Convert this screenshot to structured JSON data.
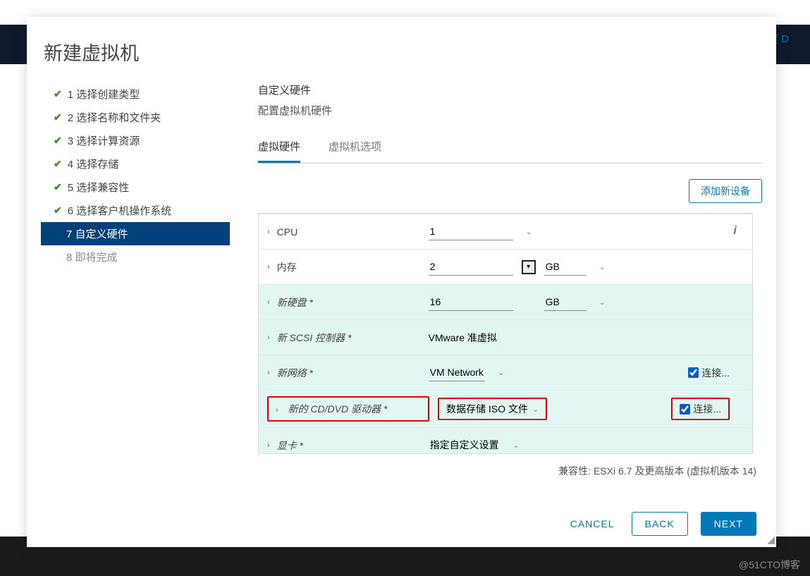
{
  "background": {
    "side_text": "度 D"
  },
  "watermark": "@51CTO博客",
  "modal": {
    "title": "新建虚拟机",
    "steps": [
      {
        "num": "1",
        "label": "选择创建类型",
        "done": true
      },
      {
        "num": "2",
        "label": "选择名称和文件夹",
        "done": true
      },
      {
        "num": "3",
        "label": "选择计算资源",
        "done": true
      },
      {
        "num": "4",
        "label": "选择存储",
        "done": true
      },
      {
        "num": "5",
        "label": "选择兼容性",
        "done": true
      },
      {
        "num": "6",
        "label": "选择客户机操作系统",
        "done": true
      },
      {
        "num": "7",
        "label": "自定义硬件",
        "active": true
      },
      {
        "num": "8",
        "label": "即将完成",
        "disabled": true
      }
    ],
    "panel": {
      "title": "自定义硬件",
      "subtitle": "配置虚拟机硬件",
      "tabs": {
        "hw": "虚拟硬件",
        "opts": "虚拟机选项"
      },
      "add_device": "添加新设备",
      "rows": {
        "cpu": {
          "label": "CPU",
          "value": "1"
        },
        "mem": {
          "label": "内存",
          "value": "2",
          "unit": "GB"
        },
        "disk": {
          "label": "新硬盘 *",
          "value": "16",
          "unit": "GB"
        },
        "scsi": {
          "label": "新 SCSI 控制器 *",
          "value": "VMware 准虚拟"
        },
        "net": {
          "label": "新网络 *",
          "value": "VM Network",
          "connect": "连接..."
        },
        "cd": {
          "label": "新的 CD/DVD 驱动器 *",
          "value": "数据存储 ISO 文件",
          "connect": "连接..."
        },
        "gpu": {
          "label": "显卡 *",
          "value": "指定自定义设置"
        }
      },
      "compat": "兼容性: ESXi 6.7 及更高版本 (虚拟机版本 14)"
    },
    "footer": {
      "cancel": "CANCEL",
      "back": "BACK",
      "next": "NEXT"
    }
  }
}
